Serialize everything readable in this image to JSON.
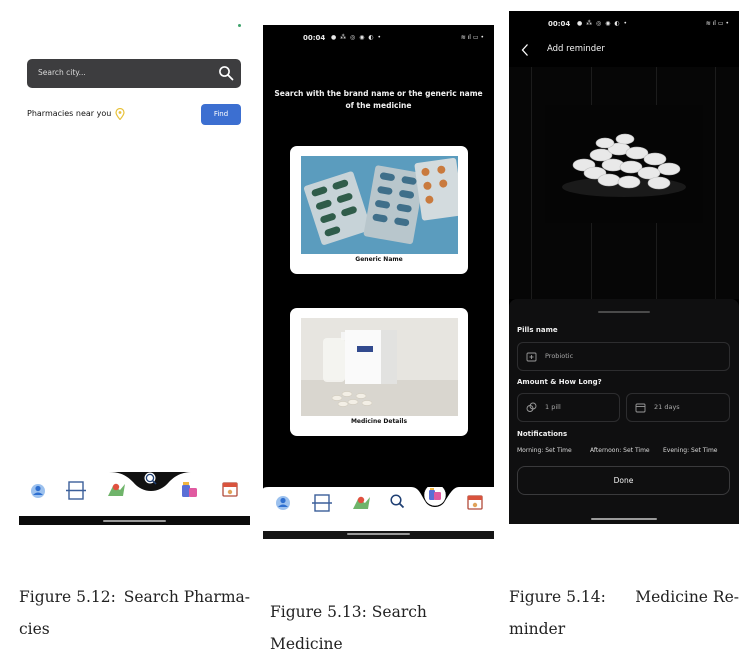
{
  "screens": {
    "pharmacies": {
      "search_placeholder": "Search city...",
      "near_label": "Pharmacies near you",
      "find_button": "Find",
      "accent": "#3c6fd1"
    },
    "medicine": {
      "status_time": "00:04",
      "heading": "Search with the brand name or the generic name of the medicine",
      "cards": [
        {
          "label": "Generic Name"
        },
        {
          "label": "Medicine Details"
        }
      ]
    },
    "reminder": {
      "status_time": "00:04",
      "title": "Add reminder",
      "pills_label": "Pills name",
      "pills_value": "Probiotic",
      "amount_label": "Amount & How Long?",
      "amount_value": "1 pill",
      "duration_value": "21 days",
      "notifications_label": "Notifications",
      "morning": "Morning: Set Time",
      "afternoon": "Afternoon: Set Time",
      "evening": "Evening: Set Time",
      "done_button": "Done"
    }
  },
  "captions": {
    "fig1_line1_a": "Figure 5.12:",
    "fig1_line1_b": "Search Pharma-",
    "fig1_line2": "cies",
    "fig2": "Figure 5.13: Search Medicine",
    "fig3_line1_a": "Figure 5.14:",
    "fig3_line1_b": "Medicine Re-",
    "fig3_line2": "minder"
  }
}
